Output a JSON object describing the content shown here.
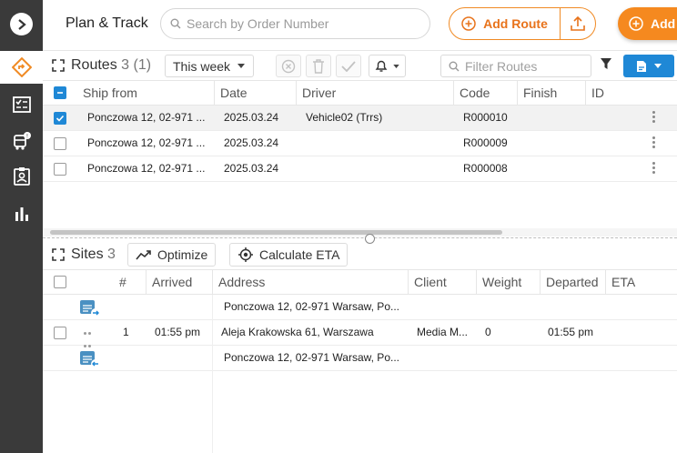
{
  "header": {
    "title": "Plan & Track",
    "search_placeholder": "Search by Order Number",
    "add_route_label": "Add Route",
    "add_label": "Add"
  },
  "routes": {
    "title": "Routes",
    "count": "3 (1)",
    "period": "This week",
    "filter_placeholder": "Filter Routes",
    "columns": [
      "Ship from",
      "Date",
      "Driver",
      "Code",
      "Finish",
      "ID"
    ],
    "rows": [
      {
        "ship_from": "Ponczowa 12, 02-971 ...",
        "date": "2025.03.24",
        "driver": "Vehicle02 (Trrs)",
        "code": "R000010",
        "finish": "",
        "id": "",
        "checked": true
      },
      {
        "ship_from": "Ponczowa 12, 02-971 ...",
        "date": "2025.03.24",
        "driver": "",
        "code": "R000009",
        "finish": "",
        "id": "",
        "checked": false
      },
      {
        "ship_from": "Ponczowa 12, 02-971 ...",
        "date": "2025.03.24",
        "driver": "",
        "code": "R000008",
        "finish": "",
        "id": "",
        "checked": false
      }
    ]
  },
  "sites": {
    "title": "Sites",
    "count": "3",
    "optimize_label": "Optimize",
    "eta_label": "Calculate ETA",
    "columns": [
      "#",
      "Arrived",
      "Address",
      "Client",
      "Weight",
      "Departed",
      "ETA"
    ],
    "rows": [
      {
        "type": "depot-start",
        "num": "",
        "arrived": "",
        "address": "Ponczowa 12, 02-971 Warsaw, Po...",
        "client": "",
        "weight": "",
        "departed": "",
        "eta": ""
      },
      {
        "type": "stop",
        "num": "1",
        "arrived": "01:55 pm",
        "address": "Aleja Krakowska 61, Warszawa",
        "client": "Media M...",
        "weight": "0",
        "departed": "01:55 pm",
        "eta": ""
      },
      {
        "type": "depot-end",
        "num": "",
        "arrived": "",
        "address": "Ponczowa 12, 02-971 Warsaw, Po...",
        "client": "",
        "weight": "",
        "departed": "",
        "eta": ""
      }
    ]
  },
  "sidebar": {
    "items": [
      {
        "icon": "route-icon",
        "active": true
      },
      {
        "icon": "checklist-icon",
        "active": false
      },
      {
        "icon": "truck-alert-icon",
        "active": false
      },
      {
        "icon": "contact-card-icon",
        "active": false
      },
      {
        "icon": "bar-chart-icon",
        "active": false
      }
    ]
  },
  "colors": {
    "accent": "#f5891f",
    "primary": "#1f88d6",
    "sidebar": "#3a3a3a"
  }
}
